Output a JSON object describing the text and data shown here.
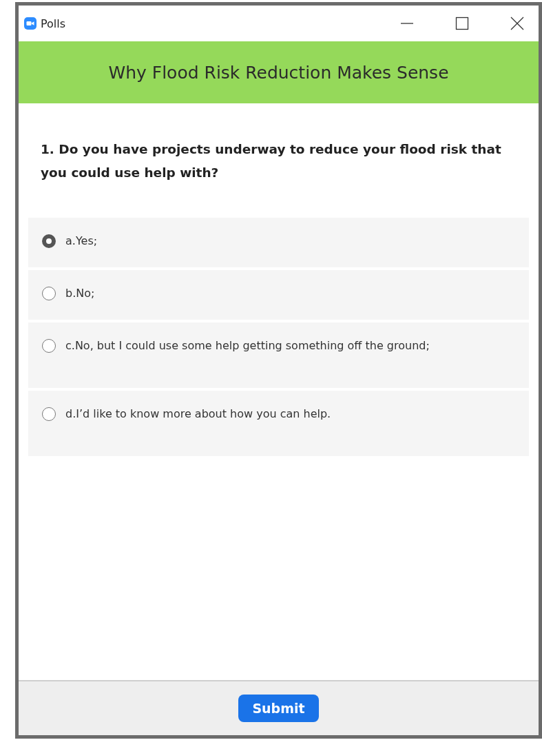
{
  "window": {
    "title": "Polls"
  },
  "poll": {
    "title": "Why Flood Risk Reduction Makes Sense",
    "question": "1. Do you have projects underway to reduce your flood risk that you could use help with?",
    "options": [
      {
        "label": "a.Yes;",
        "selected": true,
        "tall": false
      },
      {
        "label": "b.No;",
        "selected": false,
        "tall": false
      },
      {
        "label": "c.No, but I could use some help getting something off the ground;",
        "selected": false,
        "tall": true
      },
      {
        "label": "d.I’d like to know more about how you can help.",
        "selected": false,
        "tall": true
      }
    ]
  },
  "footer": {
    "button": "Submit"
  }
}
